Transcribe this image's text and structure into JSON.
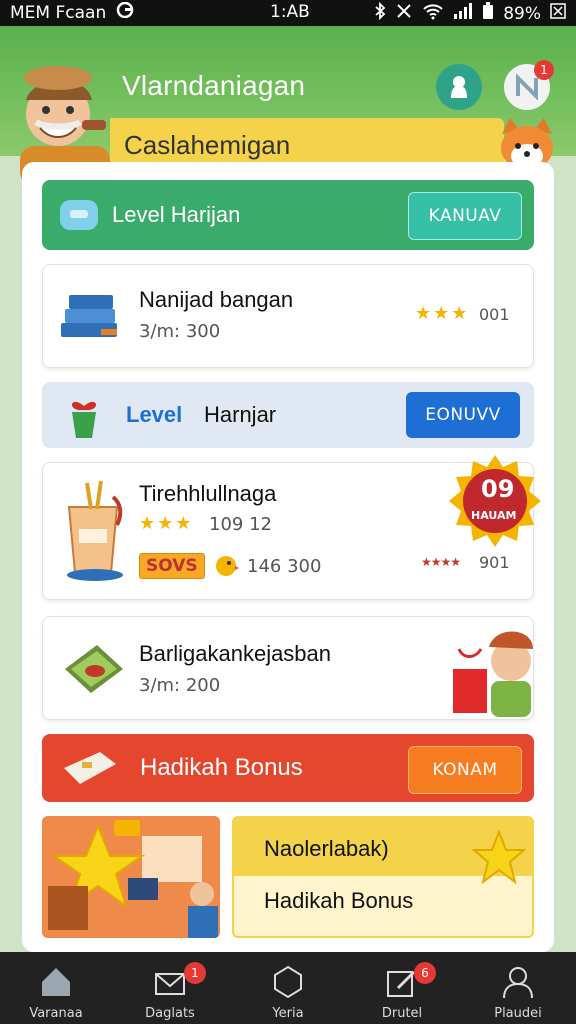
{
  "status_bar": {
    "carrier": "MEM Fcaan",
    "time": "1:AB",
    "battery": "89%"
  },
  "header": {
    "title": "Vlarndaniagan",
    "banner": "Caslahemigan",
    "notification_count": "1"
  },
  "rows": {
    "level1": {
      "label": "Level Harijan",
      "button": "KANUAV"
    },
    "item1": {
      "title": "Nanijad bangan",
      "sub": "3/m: 300",
      "stars_text": "001"
    },
    "level2": {
      "label_a": "Level",
      "label_b": "Harnjar",
      "button": "EONUVV"
    },
    "item2": {
      "title": "Tirehhlullnaga",
      "rating": "109 12",
      "badge": "SOVS",
      "price": "146 300",
      "seal_num": "09",
      "seal_text": "HAUAM",
      "right_count": "901"
    },
    "item3": {
      "title": "Barligakankejasban",
      "sub": "3/m: 200"
    },
    "bonus": {
      "label": "Hadikah Bonus",
      "button": "KONAM"
    }
  },
  "promo": {
    "line1": "Naolerlabak)",
    "line2": "Hadikah Bonus"
  },
  "nav": [
    {
      "label": "Varanaa",
      "icon": "home-icon"
    },
    {
      "label": "Daglats",
      "icon": "mail-icon",
      "badge": "1"
    },
    {
      "label": "Yeria",
      "icon": "hexagon-icon"
    },
    {
      "label": "Drutel",
      "icon": "edit-icon",
      "badge": "6"
    },
    {
      "label": "Plaudei",
      "icon": "profile-icon"
    }
  ],
  "colors": {
    "header_green": "#5bb04f",
    "level_green": "#3bab6b",
    "bonus_red": "#e4472e",
    "blue_button": "#1d6fd6",
    "banner_yellow": "#f4d24a"
  }
}
